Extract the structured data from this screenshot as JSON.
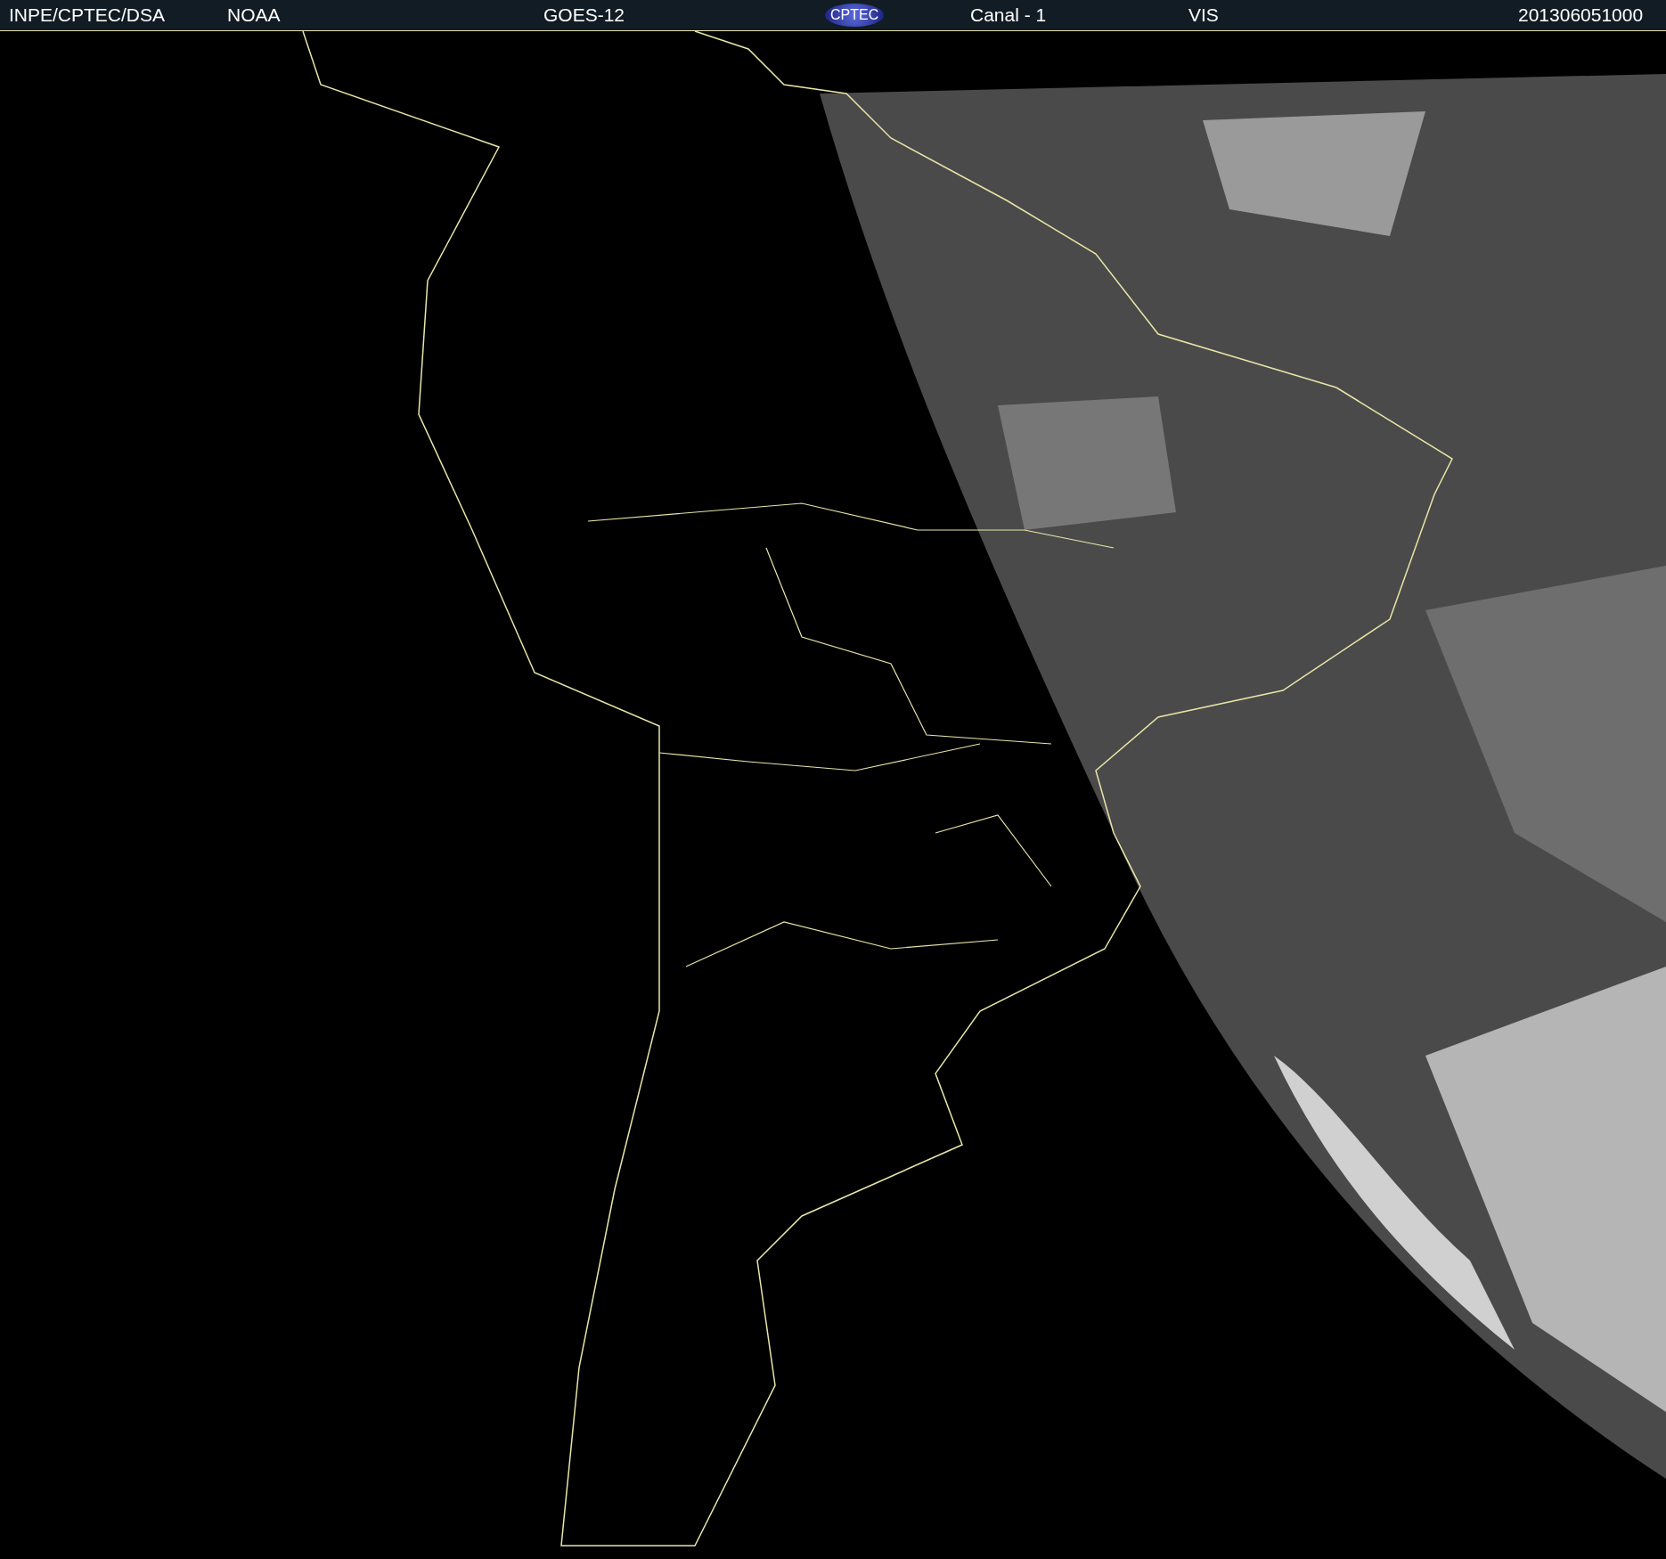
{
  "header": {
    "items": [
      {
        "kind": "text",
        "text": "INPE/CPTEC/DSA"
      },
      {
        "kind": "text",
        "text": "NOAA"
      },
      {
        "kind": "text",
        "text": "GOES-12"
      },
      {
        "kind": "logo",
        "text": "CPTEC"
      },
      {
        "kind": "text",
        "text": "Canal - 1"
      },
      {
        "kind": "text",
        "text": "VIS"
      },
      {
        "kind": "text",
        "text": "201306051000"
      }
    ]
  }
}
